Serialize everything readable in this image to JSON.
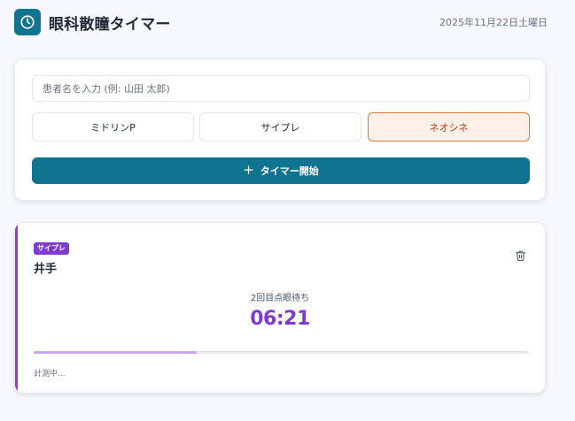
{
  "header": {
    "title": "眼科散瞳タイマー",
    "date": "2025年11月22日土曜日",
    "logo_icon": "clock-icon"
  },
  "form": {
    "patient_input_value": "",
    "patient_input_placeholder": "患者名を入力 (例: 山田 太郎)",
    "drugs": [
      {
        "label": "ミドリンP",
        "selected": false
      },
      {
        "label": "サイプレ",
        "selected": false
      },
      {
        "label": "ネオシネ",
        "selected": true
      }
    ],
    "start_button_icon": "plus-icon",
    "start_button_label": "タイマー開始"
  },
  "timer": {
    "drug_badge": "サイプレ",
    "patient_name": "井手",
    "phase_label": "2回目点眼待ち",
    "countdown": "06:21",
    "progress": 0.33,
    "status": "計測中...",
    "delete_icon": "trash-icon",
    "accent_color": "#8b3fd1"
  },
  "colors": {
    "primary": "#0e7490",
    "selected_drug": "#d97a3f",
    "badge": "#7e3bd0"
  }
}
